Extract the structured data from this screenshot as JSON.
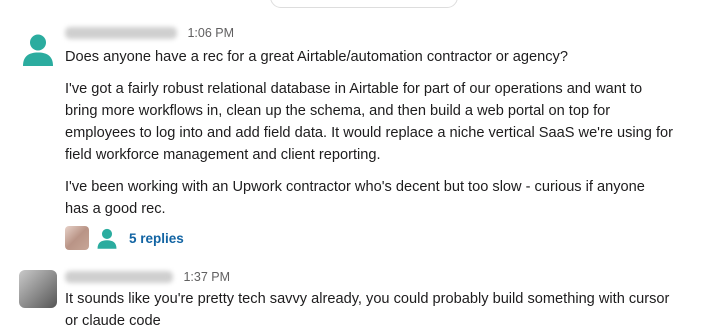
{
  "messages": [
    {
      "time": "1:06 PM",
      "avatar_icon": "person-icon",
      "avatar_color": "#2bac9f",
      "paragraphs": [
        [
          "Does anyone have a rec for a great Airtable/automation contractor or agency?"
        ],
        [
          "I've got a fairly robust relational database in Airtable for part of our operations and want to",
          "bring more workflows in, clean up the schema, and then build a web portal on top for",
          "employees to log into and add field data. It would replace a niche vertical SaaS we're using for",
          "field workforce management and client reporting."
        ],
        [
          "I've been working with an Upwork contractor who's decent but too slow - curious if anyone",
          "has a good rec."
        ]
      ],
      "thread": {
        "replies_label": "5 replies",
        "link_color": "#1264a3"
      }
    },
    {
      "time": "1:37 PM",
      "lines": [
        "It sounds like you're pretty tech savvy already, you could probably build something with cursor",
        "or claude code"
      ]
    }
  ]
}
